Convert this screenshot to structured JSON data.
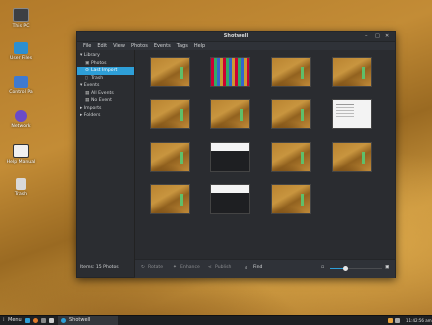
{
  "desktop": {
    "icons": [
      {
        "label": "This PC",
        "icon": "computer-icon",
        "color": "#3c3f44"
      },
      {
        "label": "User Files",
        "icon": "folder-home-icon",
        "color": "#2d8fd0"
      },
      {
        "label": "Control Pa",
        "icon": "control-panel-icon",
        "color": "#3f7ad0"
      },
      {
        "label": "Network",
        "icon": "network-globe-icon",
        "color": "#6a4bc8"
      },
      {
        "label": "Help Manual",
        "icon": "book-icon",
        "color": "#3a3a3a"
      },
      {
        "label": "Trash",
        "icon": "trash-icon",
        "color": "#d9d9d9"
      }
    ]
  },
  "window": {
    "title": "Shotwell",
    "buttons": [
      "–",
      "□",
      "✕"
    ],
    "menu": [
      "File",
      "Edit",
      "View",
      "Photos",
      "Events",
      "Tags",
      "Help"
    ]
  },
  "sidebar": {
    "library": "Library",
    "photos": "Photos",
    "last_import": "Last Import",
    "trash": "Trash",
    "events": "Events",
    "all_events": "All Events",
    "no_event": "No Event",
    "imports": "Imports",
    "folders": "Folders",
    "items_label": "Items:",
    "items_count": "15 Photos"
  },
  "thumbnails": [
    "gold",
    "mosaic",
    "gold",
    "gold",
    "gold",
    "gold",
    "gold",
    "white",
    "gold",
    "dark",
    "gold",
    "gold",
    "gold",
    "dark",
    "gold"
  ],
  "bottombar": {
    "rotate": "Rotate",
    "enhance": "Enhance",
    "publish": "Publish",
    "find": "Find",
    "zoom_fraction": 0.3
  },
  "taskbar": {
    "menu": "Menu",
    "app": "Shotwell",
    "clock": "11:42:56 am"
  }
}
